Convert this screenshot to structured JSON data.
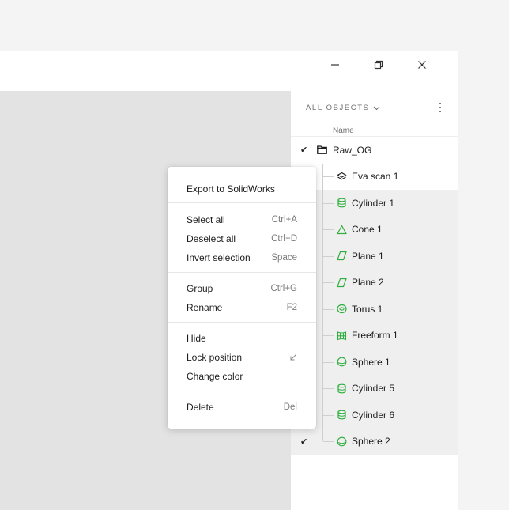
{
  "window": {
    "minimize_icon": "minimize-icon",
    "restore_icon": "restore-icon",
    "close_icon": "close-icon"
  },
  "panel": {
    "header": "ALL OBJECTS",
    "header_icon": "chevron-down-icon",
    "menu_icon": "kebab-menu-icon",
    "column_name": "Name",
    "root": {
      "label": "Raw_OG",
      "checked": true,
      "icon": "folder-icon"
    },
    "items": [
      {
        "label": "Eva scan 1",
        "icon": "scan-layers-icon",
        "selected": false,
        "checked": false
      },
      {
        "label": "Cylinder 1",
        "icon": "cylinder-icon",
        "selected": true,
        "checked": false
      },
      {
        "label": "Cone 1",
        "icon": "cone-icon",
        "selected": true,
        "checked": false
      },
      {
        "label": "Plane 1",
        "icon": "plane-icon",
        "selected": true,
        "checked": false
      },
      {
        "label": "Plane 2",
        "icon": "plane-icon",
        "selected": true,
        "checked": false
      },
      {
        "label": "Torus 1",
        "icon": "torus-icon",
        "selected": true,
        "checked": false
      },
      {
        "label": "Freeform 1",
        "icon": "freeform-icon",
        "selected": true,
        "checked": false
      },
      {
        "label": "Sphere 1",
        "icon": "sphere-icon",
        "selected": true,
        "checked": false
      },
      {
        "label": "Cylinder 5",
        "icon": "cylinder-icon",
        "selected": true,
        "checked": false
      },
      {
        "label": "Cylinder 6",
        "icon": "cylinder-icon",
        "selected": true,
        "checked": false
      },
      {
        "label": "Sphere 2",
        "icon": "sphere-icon",
        "selected": true,
        "checked": true
      }
    ]
  },
  "context_menu": {
    "export": {
      "label": "Export to SolidWorks",
      "shortcut": ""
    },
    "select_all": {
      "label": "Select all",
      "shortcut": "Ctrl+A"
    },
    "deselect_all": {
      "label": "Deselect all",
      "shortcut": "Ctrl+D"
    },
    "invert_selection": {
      "label": "Invert selection",
      "shortcut": "Space"
    },
    "group": {
      "label": "Group",
      "shortcut": "Ctrl+G"
    },
    "rename": {
      "label": "Rename",
      "shortcut": "F2"
    },
    "hide": {
      "label": "Hide",
      "shortcut": ""
    },
    "lock_position": {
      "label": "Lock position",
      "shortcut_icon": "cursor-arrow-icon"
    },
    "change_color": {
      "label": "Change color",
      "shortcut": ""
    },
    "delete": {
      "label": "Delete",
      "shortcut": "Del"
    }
  },
  "colors": {
    "accent_green": "#2fae3f",
    "selection_bg": "#efefef",
    "viewport_bg": "#e3e3e3"
  }
}
